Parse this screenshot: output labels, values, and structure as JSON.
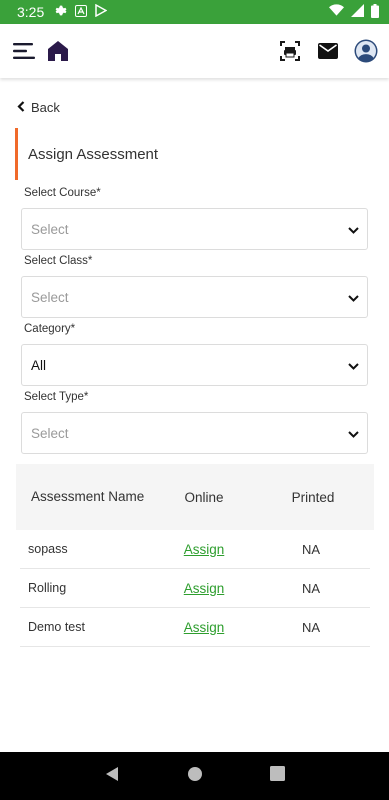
{
  "status_bar": {
    "time": "3:25",
    "bg_color": "#3aa13a"
  },
  "appbar": {
    "icons": [
      "menu-icon",
      "home-icon",
      "print-icon",
      "mail-icon",
      "profile-icon"
    ]
  },
  "back": {
    "label": "Back"
  },
  "section": {
    "title": "Assign Assessment",
    "accent_color": "#f06a2a"
  },
  "form": {
    "course": {
      "label": "Select Course*",
      "value": "Select"
    },
    "class": {
      "label": "Select Class*",
      "value": "Select"
    },
    "category": {
      "label": "Category*",
      "value": "All"
    },
    "type": {
      "label": "Select Type*",
      "value": "Select"
    }
  },
  "table": {
    "headers": {
      "name": "Assessment Name",
      "online": "Online",
      "printed": "Printed"
    },
    "rows": [
      {
        "name": "sopass",
        "online": "Assign",
        "printed": "NA"
      },
      {
        "name": "Rolling",
        "online": "Assign",
        "printed": "NA"
      },
      {
        "name": "Demo test",
        "online": "Assign",
        "printed": "NA"
      }
    ],
    "link_color": "#2e9e2e"
  }
}
